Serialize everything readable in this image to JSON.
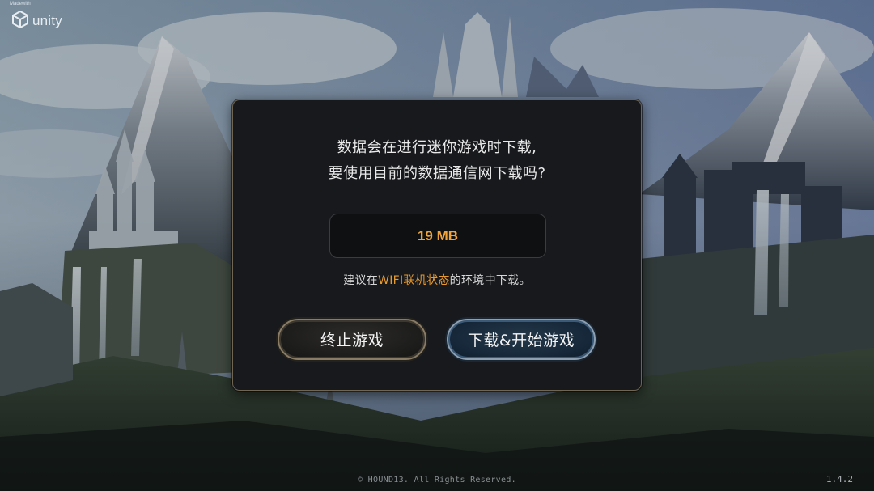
{
  "branding": {
    "made_with": "Madewith",
    "engine": "unity",
    "logo_icon": "unity-cube-icon"
  },
  "dialog": {
    "message_line1": "数据会在进行迷你游戏时下载,",
    "message_line2": "要使用目前的数据通信网下载吗?",
    "download_size": "19 MB",
    "hint_prefix": "建议在",
    "hint_highlight": "WIFI联机状态",
    "hint_suffix": "的环境中下载。",
    "quit_label": "终止游戏",
    "start_label": "下载&开始游戏"
  },
  "footer": {
    "copyright": "© HOUND13. All Rights Reserved.",
    "version": "1.4.2"
  },
  "colors": {
    "accent_orange": "#f0a33c",
    "dialog_bg": "#17191c",
    "dialog_border": "#6f6552"
  }
}
